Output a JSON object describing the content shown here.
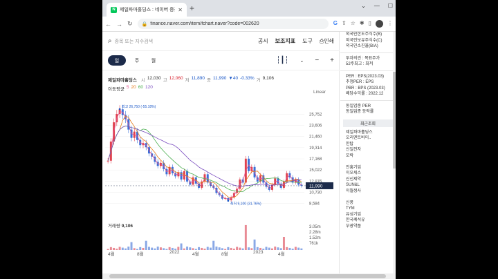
{
  "browser": {
    "tab_title": "제일파마홀딩스 : 네이버 증권",
    "favicon_letter": "N",
    "url": "finance.naver.com/item/fchart.naver?code=002620"
  },
  "search": {
    "placeholder": "종목 또는 지수검색",
    "menu": [
      "공시",
      "보조지표",
      "도구",
      "인쇄"
    ]
  },
  "periods": {
    "active": "일",
    "others": [
      "주",
      "월"
    ]
  },
  "quote": {
    "name": "제일파마홀딩스",
    "open_label": "시",
    "open": "12,030",
    "high_label": "고",
    "high": "12,060",
    "low_label": "저",
    "low": "11,890",
    "close_label": "종",
    "close": "11,990",
    "change": "▼40",
    "change_pct": "-0.33%",
    "volume_label": "거",
    "volume": "9,106"
  },
  "moving_avg": {
    "label": "이동평균",
    "items": [
      "5",
      "20",
      "60",
      "120"
    ]
  },
  "scale_mode": "Linear",
  "chart_data": {
    "type": "candlestick",
    "title": "",
    "y_ticks": [
      25752,
      23606,
      21460,
      19314,
      17168,
      15022,
      12876,
      10730,
      8584
    ],
    "ylim": [
      7600,
      27800
    ],
    "current_price": "11,990",
    "annotations": [
      {
        "label": "최고 26,750 (-55.18%)",
        "value": 26750
      },
      {
        "label": "최저 9,100 (31.76%)",
        "value": 9100
      }
    ],
    "x_labels": [
      "4월",
      "8월",
      "2022",
      "4월",
      "8월",
      "2023",
      "4월"
    ],
    "approx_close": [
      16800,
      20500,
      24200,
      25800,
      26700,
      25600,
      24800,
      22800,
      21200,
      22400,
      20800,
      19800,
      20200,
      19400,
      18200,
      17600,
      16600,
      15800,
      16400,
      15200,
      14200,
      15600,
      14400,
      13800,
      14600,
      13200,
      14800,
      12800,
      12200,
      13600,
      12400,
      11600,
      12800,
      14200,
      12600,
      12000,
      11600,
      10600,
      10200,
      9500,
      9600,
      9200,
      9800,
      10600,
      11400,
      13200,
      12600,
      17200,
      14800,
      15600,
      13600,
      12800,
      14000,
      12600,
      11800,
      11200,
      12200,
      13400,
      12400,
      11600,
      12800,
      14400,
      13600,
      12600,
      13200,
      12200,
      11990
    ],
    "volume": {
      "label": "거래량",
      "value": "9,106",
      "y_ticks": [
        "3.05m",
        "2.28m",
        "1.52m",
        "761k"
      ]
    }
  },
  "side_panel": {
    "top_items": [
      "외국인한도주식수(B)",
      "외국인보유주식수(C)",
      "외국인소진율(B/A)"
    ],
    "opinion": [
      "투자의견 : 목표주가",
      "52주최고 : 최저"
    ],
    "per": [
      "PER : EPS(2023.03)",
      "추정PER : EPS",
      "PBR : BPS (2023.03)",
      "배당수익률 : 2022.12"
    ],
    "industry": [
      "동일업종 PER",
      "동일업종 등락률"
    ],
    "recent_title": "최근조회",
    "recent": [
      "제일파마홀딩스",
      "오리엔트바이..",
      "한탑",
      "신일전자",
      "모락",
      "",
      "진흥기업",
      "이오세스",
      "신신제약",
      "SUN&L",
      "이월생사",
      "",
      "신풍",
      "TYM",
      "유성기업",
      "한국쎄석유",
      "부광약품"
    ]
  }
}
